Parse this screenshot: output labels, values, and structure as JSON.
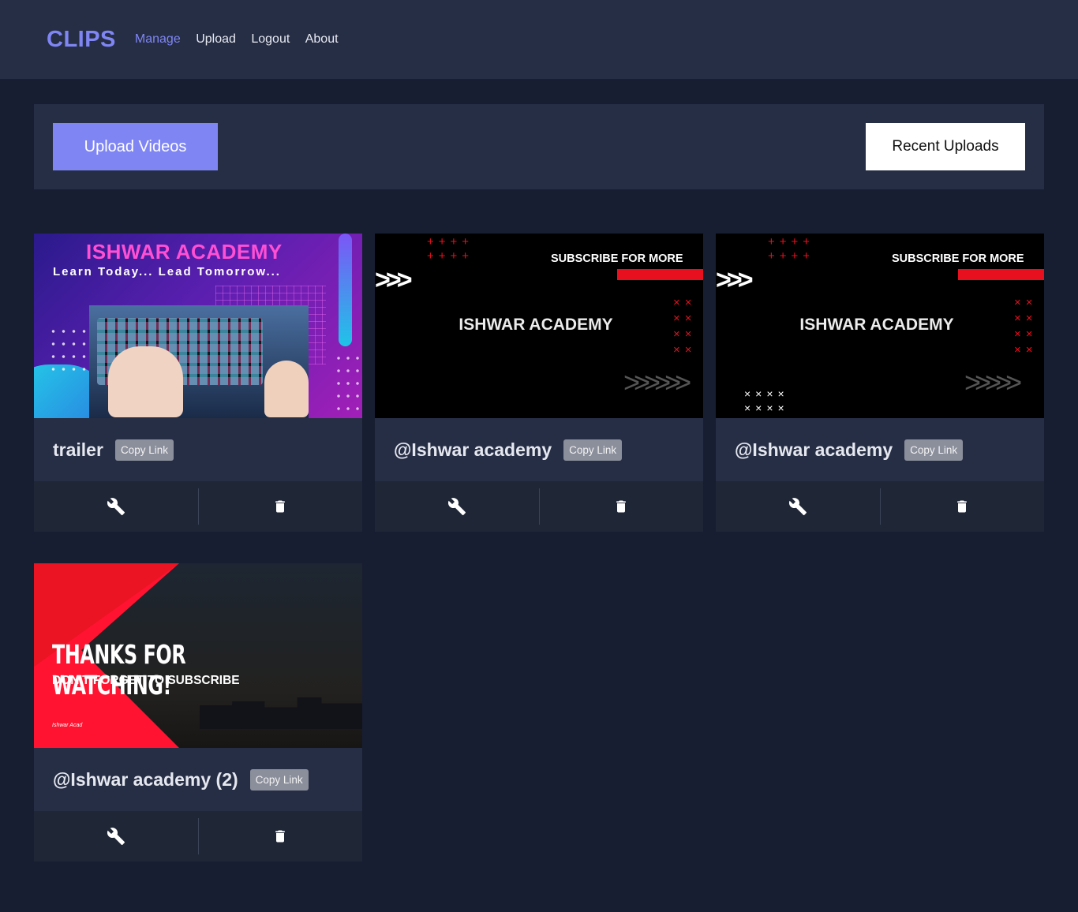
{
  "nav": {
    "brand": "CLIPS",
    "links": [
      "Manage",
      "Upload",
      "Logout",
      "About"
    ],
    "active": "Manage"
  },
  "toolbar": {
    "upload_label": "Upload Videos",
    "recent_label": "Recent Uploads"
  },
  "clips": [
    {
      "title": "trailer",
      "copy_label": "Copy Link",
      "thumb": {
        "heading": "ISHWAR ACADEMY",
        "tagline": "Learn Today... Lead Tomorrow..."
      }
    },
    {
      "title": "@Ishwar academy",
      "copy_label": "Copy Link",
      "thumb": {
        "center": "ISHWAR ACADEMY",
        "banner": "SUBSCRIBE FOR MORE"
      }
    },
    {
      "title": "@Ishwar academy",
      "copy_label": "Copy Link",
      "thumb": {
        "center": "ISHWAR ACADEMY",
        "banner": "SUBSCRIBE FOR MORE"
      }
    },
    {
      "title": "@Ishwar academy (2)",
      "copy_label": "Copy Link",
      "thumb": {
        "heading": "THANKS FOR WATCHING!",
        "sub": "DON'T FORGET TO SUBSCRIBE",
        "signature": "Ishwar Acad"
      }
    }
  ],
  "icons": {
    "edit": "wrench-icon",
    "delete": "trash-icon"
  },
  "colors": {
    "accent": "#7f86f4",
    "background": "#181e31",
    "panel": "#262e45"
  }
}
